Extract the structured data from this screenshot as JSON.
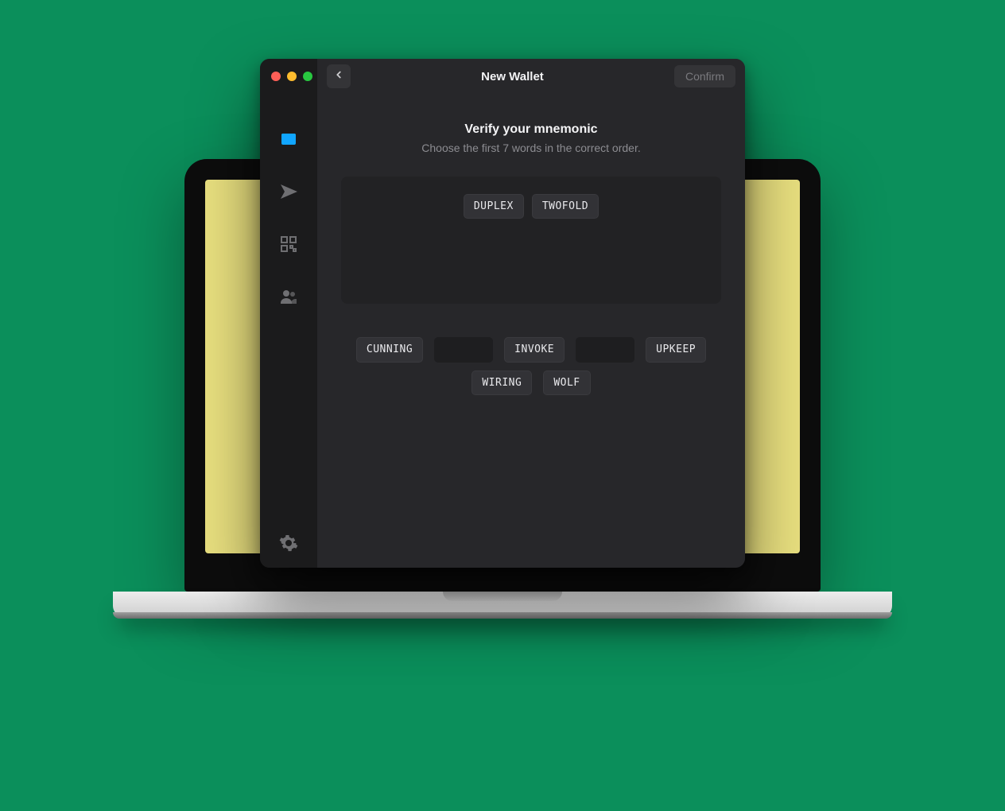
{
  "titlebar": {
    "title": "New Wallet",
    "confirm_label": "Confirm"
  },
  "verify": {
    "heading": "Verify your mnemonic",
    "subheading": "Choose the first 7 words in the correct order."
  },
  "chosen_words": [
    "DUPLEX",
    "TWOFOLD"
  ],
  "pool_items": [
    {
      "kind": "word",
      "text": "CUNNING"
    },
    {
      "kind": "slot"
    },
    {
      "kind": "word",
      "text": "INVOKE"
    },
    {
      "kind": "slot"
    },
    {
      "kind": "word",
      "text": "UPKEEP"
    },
    {
      "kind": "word",
      "text": "WIRING"
    },
    {
      "kind": "word",
      "text": "WOLF"
    }
  ],
  "sidebar": {
    "items": [
      {
        "name": "wallet",
        "active": true
      },
      {
        "name": "send",
        "active": false
      },
      {
        "name": "receive",
        "active": false
      },
      {
        "name": "contacts",
        "active": false
      }
    ],
    "bottom": {
      "name": "settings"
    }
  }
}
